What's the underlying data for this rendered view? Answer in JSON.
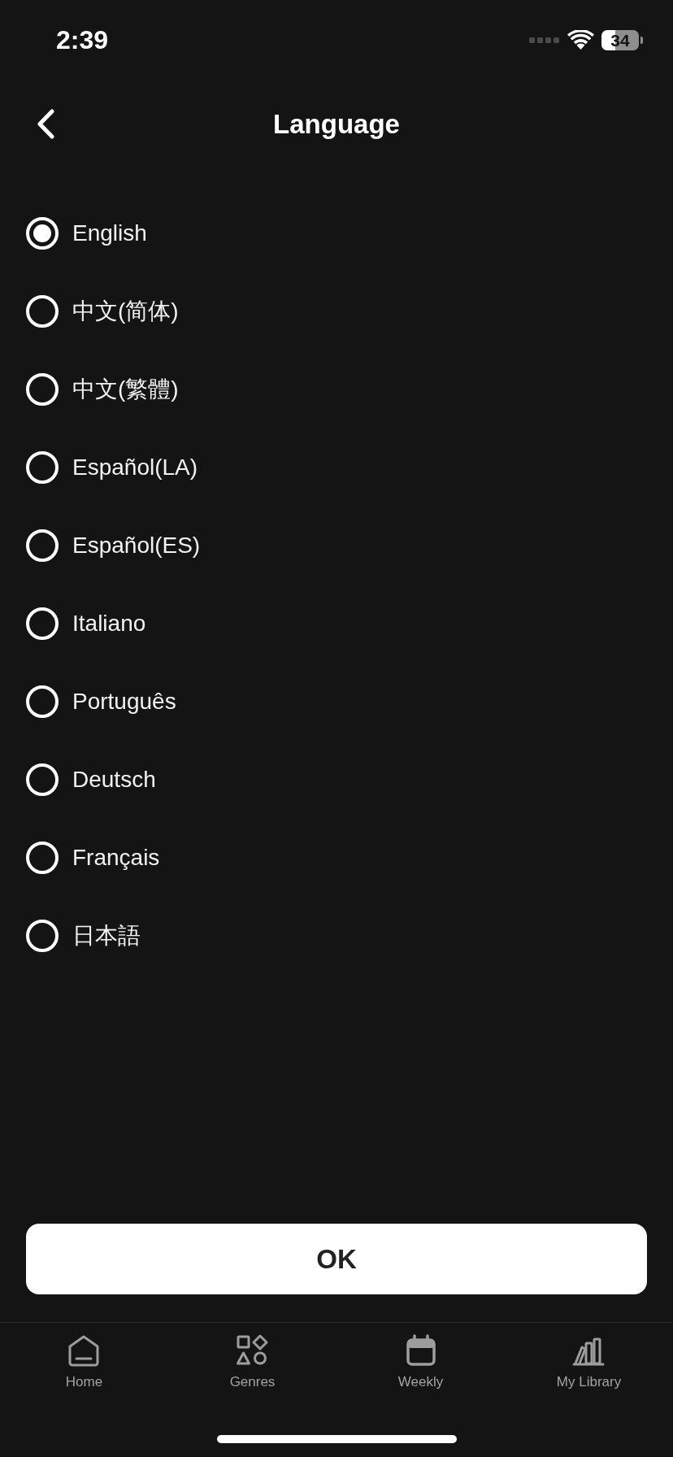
{
  "status_bar": {
    "time": "2:39",
    "battery": "34"
  },
  "header": {
    "title": "Language"
  },
  "languages": [
    {
      "label": "English",
      "selected": true
    },
    {
      "label": "中文(简体)",
      "selected": false
    },
    {
      "label": "中文(繁體)",
      "selected": false
    },
    {
      "label": "Español(LA)",
      "selected": false
    },
    {
      "label": "Español(ES)",
      "selected": false
    },
    {
      "label": "Italiano",
      "selected": false
    },
    {
      "label": "Português",
      "selected": false
    },
    {
      "label": "Deutsch",
      "selected": false
    },
    {
      "label": "Français",
      "selected": false
    },
    {
      "label": "日本語",
      "selected": false
    }
  ],
  "ok_button": {
    "label": "OK"
  },
  "tab_bar": [
    {
      "kind": "home",
      "label": "Home"
    },
    {
      "kind": "genres",
      "label": "Genres"
    },
    {
      "kind": "weekly",
      "label": "Weekly"
    },
    {
      "kind": "library",
      "label": "My Library"
    }
  ]
}
